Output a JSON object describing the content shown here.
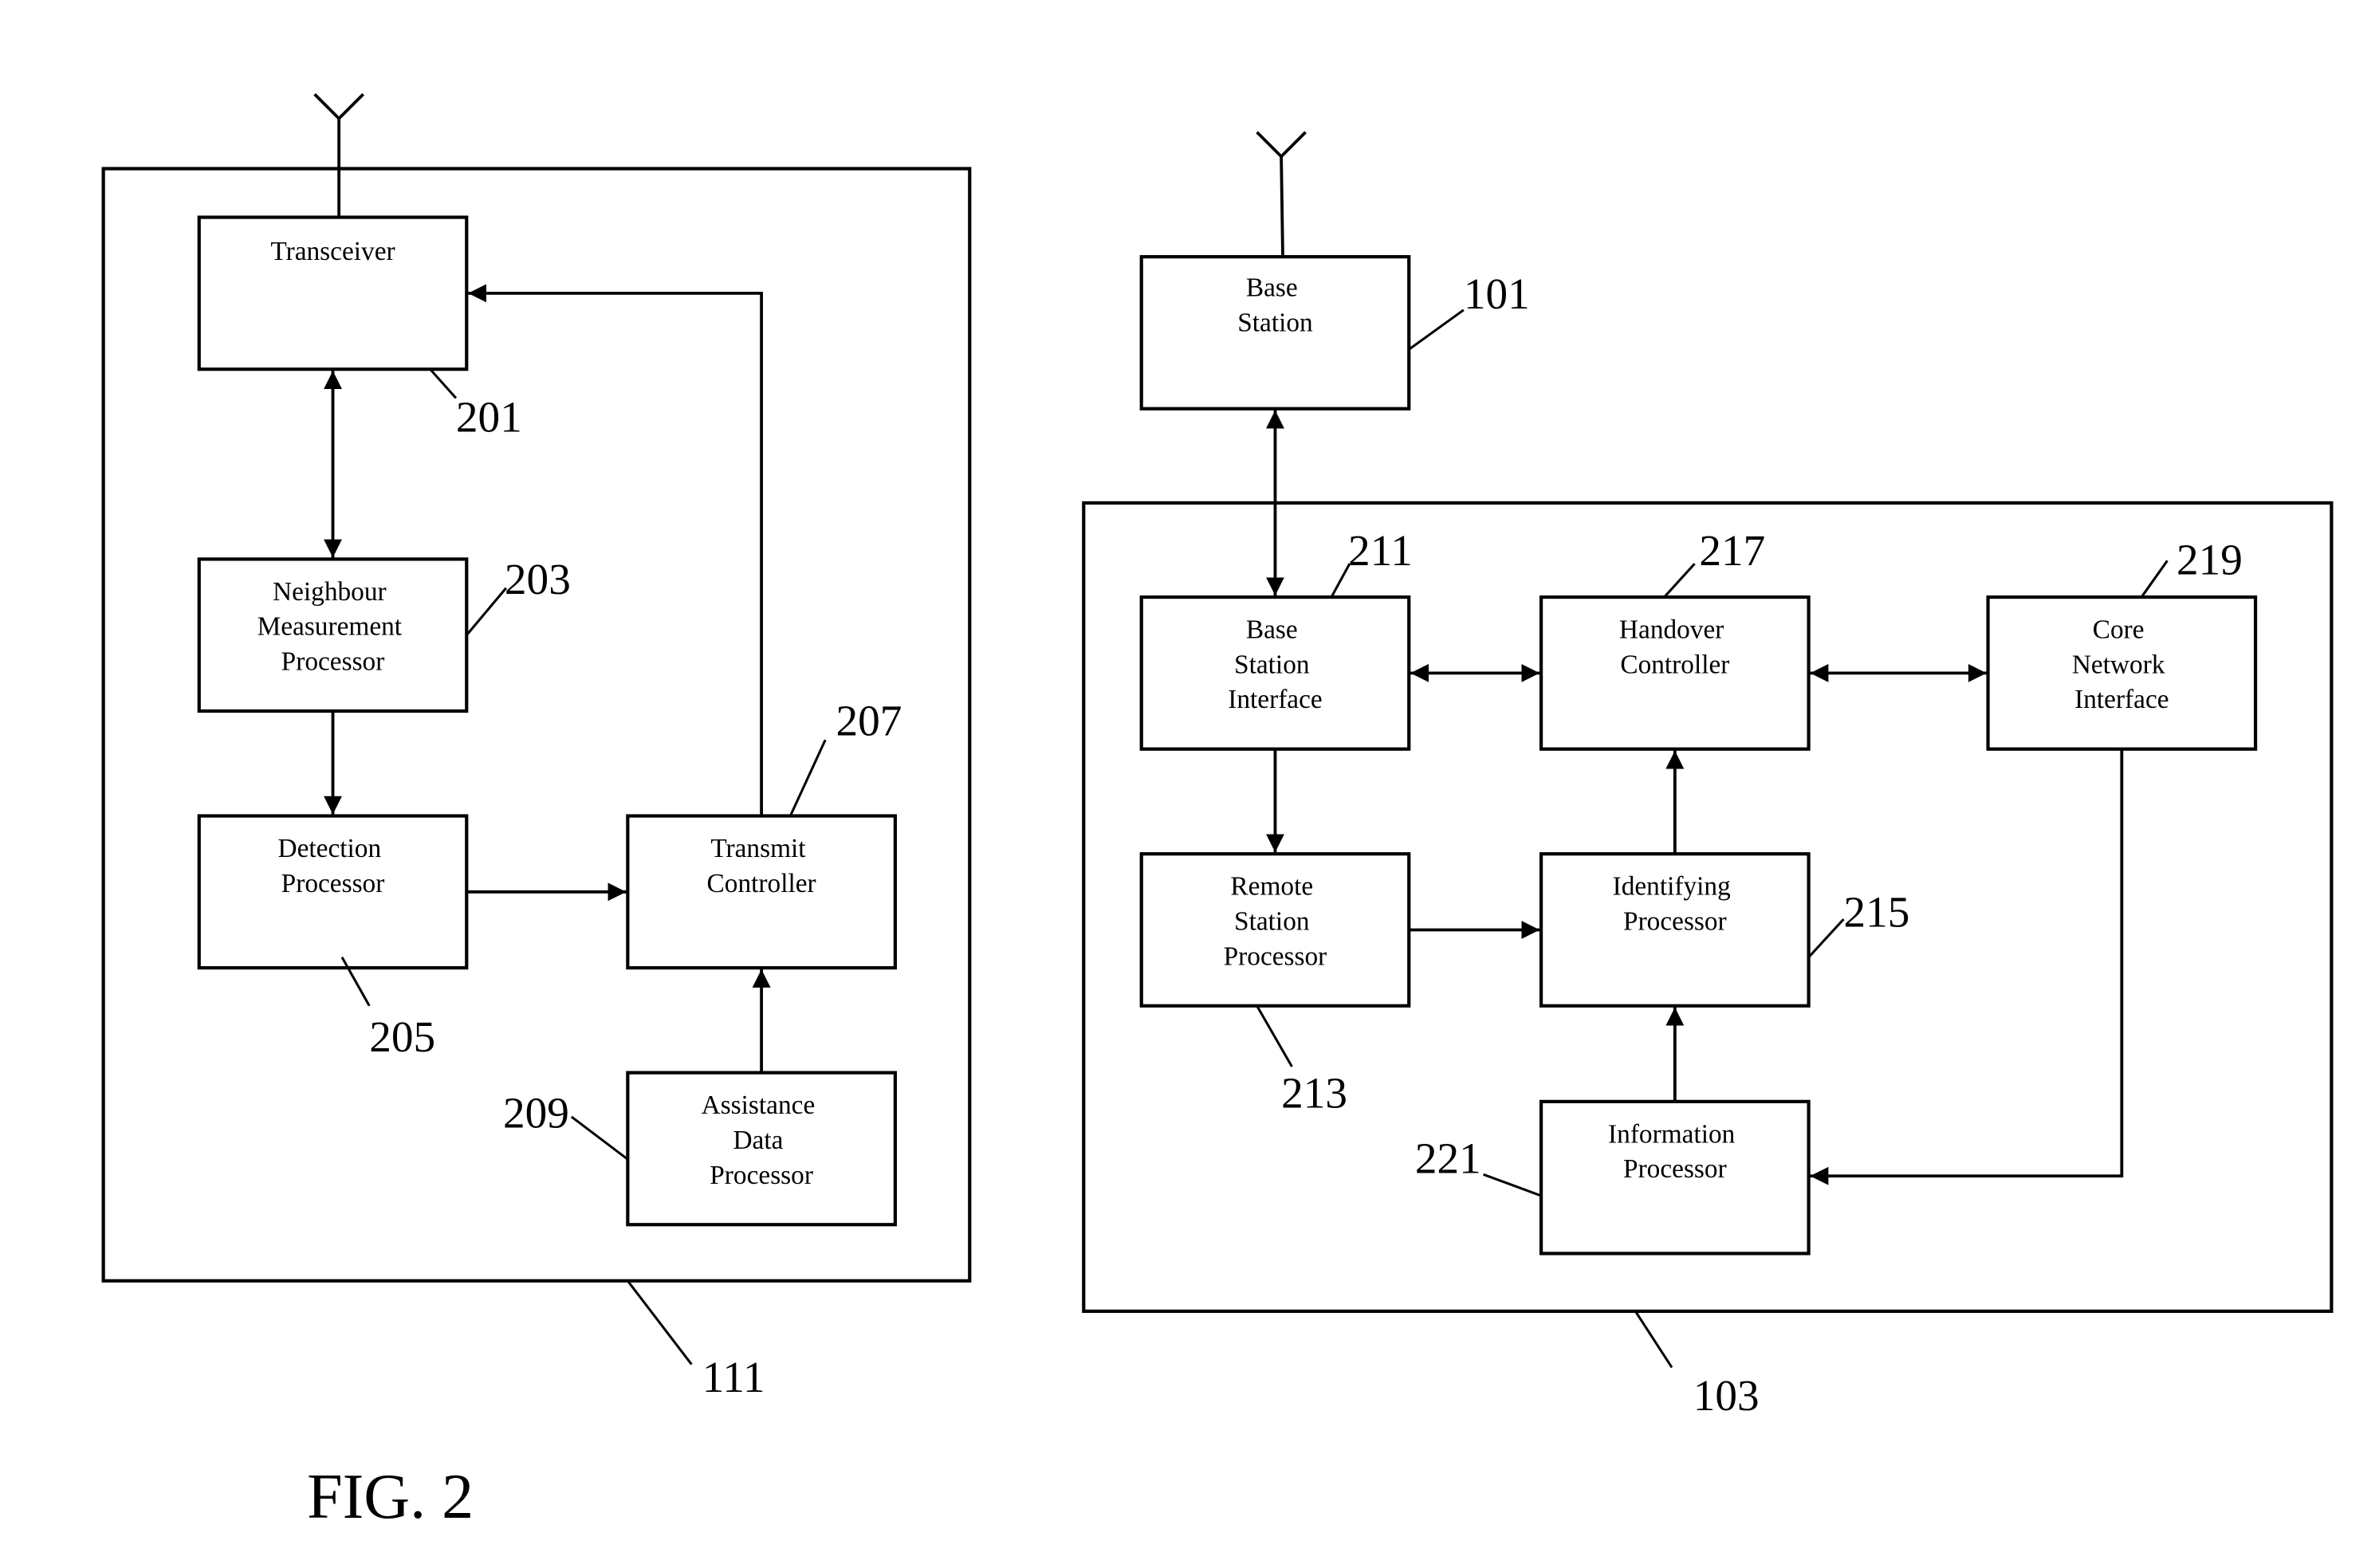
{
  "figure": {
    "label": "FIG. 2"
  },
  "remote_station": {
    "ref": "111",
    "blocks": {
      "transceiver": {
        "ref": "201",
        "lines": [
          "Transceiver"
        ]
      },
      "neighbour_measurement": {
        "ref": "203",
        "lines": [
          "Neighbour",
          "Measurement",
          "Processor"
        ]
      },
      "detection": {
        "ref": "205",
        "lines": [
          "Detection",
          "Processor"
        ]
      },
      "transmit_controller": {
        "ref": "207",
        "lines": [
          "Transmit",
          "Controller"
        ]
      },
      "assistance_data": {
        "ref": "209",
        "lines": [
          "Assistance",
          "Data",
          "Processor"
        ]
      }
    }
  },
  "base_station": {
    "ref": "101",
    "lines": [
      "Base",
      "Station"
    ]
  },
  "network_element": {
    "ref": "103",
    "blocks": {
      "base_station_interface": {
        "ref": "211",
        "lines": [
          "Base",
          "Station",
          "Interface"
        ]
      },
      "remote_station_processor": {
        "ref": "213",
        "lines": [
          "Remote",
          "Station",
          "Processor"
        ]
      },
      "identifying_processor": {
        "ref": "215",
        "lines": [
          "Identifying",
          "Processor"
        ]
      },
      "handover_controller": {
        "ref": "217",
        "lines": [
          "Handover",
          "Controller"
        ]
      },
      "core_network_interface": {
        "ref": "219",
        "lines": [
          "Core",
          "Network",
          "Interface"
        ]
      },
      "information_processor": {
        "ref": "221",
        "lines": [
          "Information",
          "Processor"
        ]
      }
    }
  },
  "connections": [
    {
      "from": "transceiver",
      "to": "neighbour_measurement",
      "direction": "bidirectional"
    },
    {
      "from": "neighbour_measurement",
      "to": "detection",
      "direction": "forward"
    },
    {
      "from": "detection",
      "to": "transmit_controller",
      "direction": "forward"
    },
    {
      "from": "assistance_data",
      "to": "transmit_controller",
      "direction": "forward"
    },
    {
      "from": "transmit_controller",
      "to": "transceiver",
      "direction": "forward"
    },
    {
      "from": "base_station",
      "to": "base_station_interface",
      "direction": "bidirectional"
    },
    {
      "from": "base_station_interface",
      "to": "handover_controller",
      "direction": "bidirectional"
    },
    {
      "from": "handover_controller",
      "to": "core_network_interface",
      "direction": "bidirectional"
    },
    {
      "from": "base_station_interface",
      "to": "remote_station_processor",
      "direction": "forward"
    },
    {
      "from": "remote_station_processor",
      "to": "identifying_processor",
      "direction": "forward"
    },
    {
      "from": "identifying_processor",
      "to": "handover_controller",
      "direction": "forward"
    },
    {
      "from": "information_processor",
      "to": "identifying_processor",
      "direction": "forward"
    },
    {
      "from": "core_network_interface",
      "to": "information_processor",
      "direction": "forward"
    }
  ]
}
